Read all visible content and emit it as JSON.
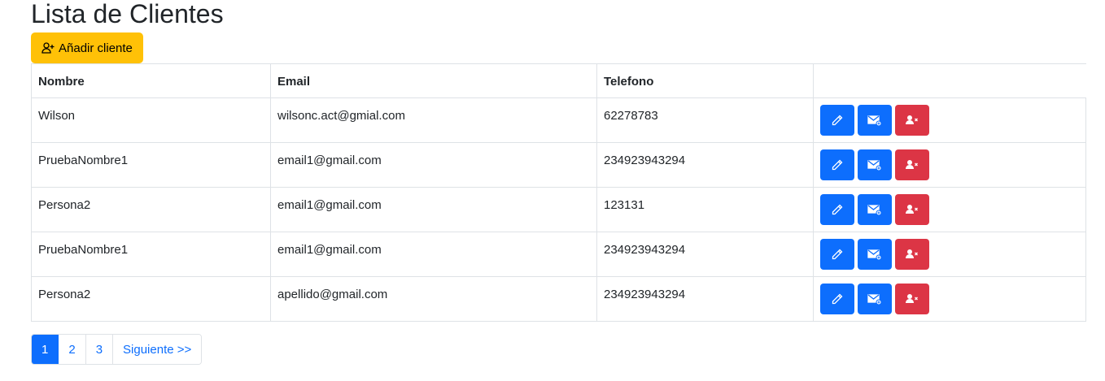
{
  "page": {
    "title": "Lista de Clientes"
  },
  "toolbar": {
    "add_label": "Añadir cliente",
    "add_icon": "person-add-icon",
    "add_color": "#ffc107"
  },
  "table": {
    "columns": [
      "Nombre",
      "Email",
      "Telefono",
      ""
    ],
    "rows": [
      {
        "nombre": "Wilson",
        "email": "wilsonc.act@gmial.com",
        "telefono": "62278783"
      },
      {
        "nombre": "PruebaNombre1",
        "email": "email1@gmail.com",
        "telefono": "234923943294"
      },
      {
        "nombre": "Persona2",
        "email": "email1@gmail.com",
        "telefono": "123131"
      },
      {
        "nombre": "PruebaNombre1",
        "email": "email1@gmail.com",
        "telefono": "234923943294"
      },
      {
        "nombre": "Persona2",
        "email": "apellido@gmail.com",
        "telefono": "234923943294"
      }
    ],
    "row_actions": [
      {
        "name": "edit",
        "icon": "pencil-icon",
        "color": "#0d6efd"
      },
      {
        "name": "mail",
        "icon": "envelope-icon",
        "color": "#0d6efd"
      },
      {
        "name": "delete",
        "icon": "person-x-icon",
        "color": "#dc3545"
      }
    ]
  },
  "pagination": {
    "pages": [
      "1",
      "2",
      "3"
    ],
    "active_page": "1",
    "next_label": "Siguiente >>",
    "accent": "#0d6efd"
  }
}
